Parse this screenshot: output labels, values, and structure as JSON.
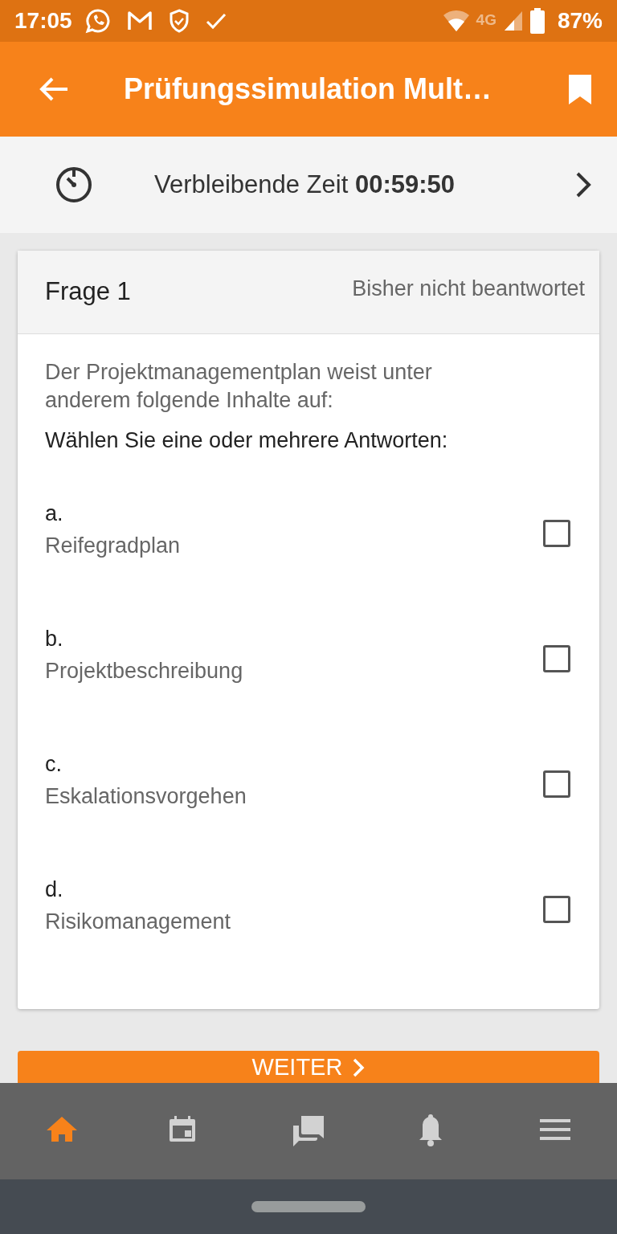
{
  "status_bar": {
    "time": "17:05",
    "network": "4G",
    "battery": "87%"
  },
  "app_bar": {
    "title": "Prüfungssimulation Mult…"
  },
  "timer": {
    "label": "Verbleibende Zeit",
    "value": "00:59:50"
  },
  "question": {
    "title": "Frage 1",
    "status": "Bisher nicht beantwortet",
    "text": "Der Projektmanagementplan weist unter anderem folgende Inhalte auf:",
    "prompt": "Wählen Sie eine oder mehrere Antworten:"
  },
  "answers": [
    {
      "letter": "a.",
      "text": "Reifegradplan",
      "checked": false
    },
    {
      "letter": "b.",
      "text": "Projektbeschreibung",
      "checked": false
    },
    {
      "letter": "c.",
      "text": "Eskalationsvorgehen",
      "checked": false
    },
    {
      "letter": "d.",
      "text": "Risikomanagement",
      "checked": false
    }
  ],
  "next_button": {
    "label": "WEITER"
  },
  "bottom_nav": [
    {
      "kind": "home",
      "selected": true
    },
    {
      "kind": "calendar",
      "selected": false
    },
    {
      "kind": "chat",
      "selected": false
    },
    {
      "kind": "bell",
      "selected": false
    },
    {
      "kind": "menu",
      "selected": false
    }
  ]
}
